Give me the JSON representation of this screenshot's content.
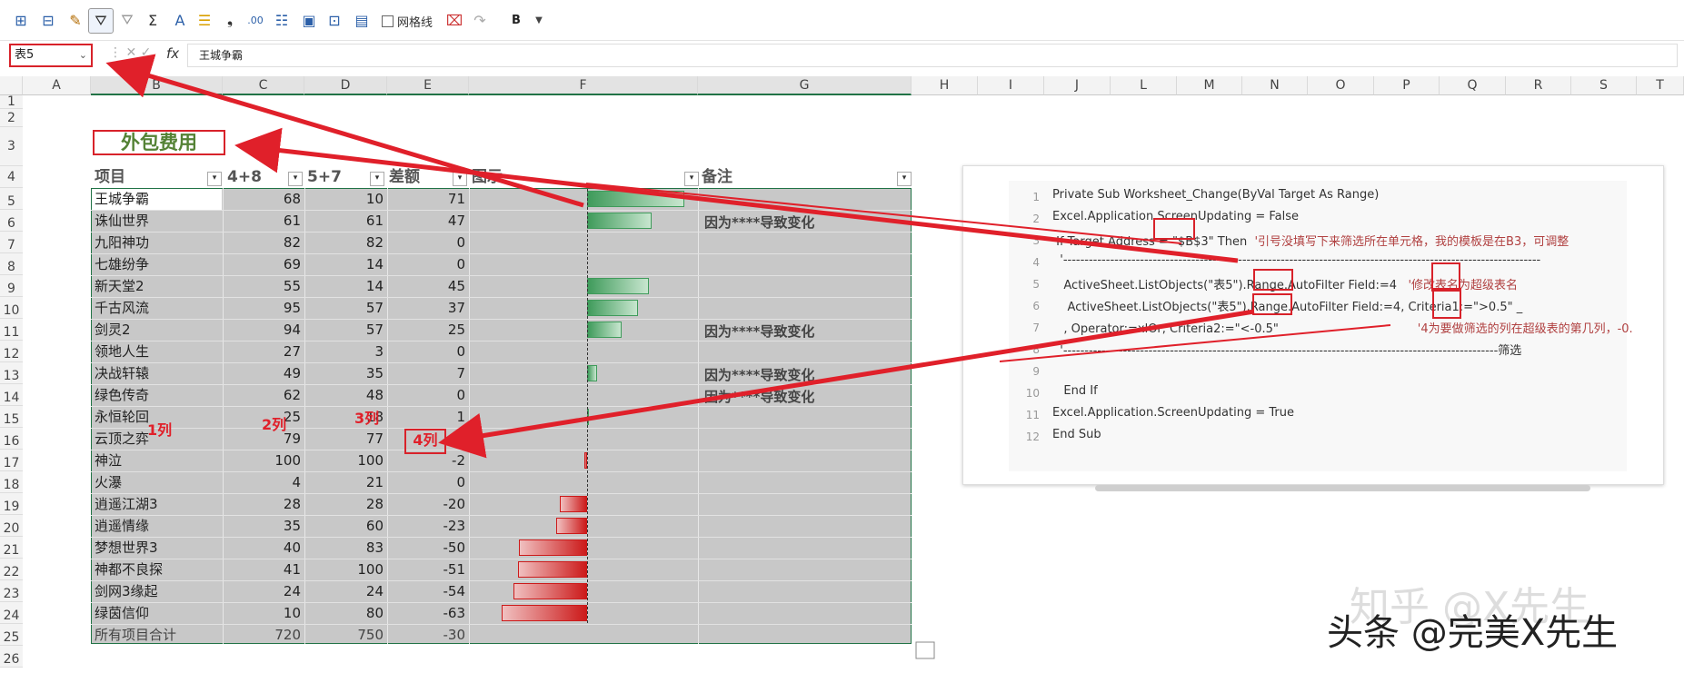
{
  "toolbar": {
    "gridlines_label": "网格线",
    "bold_label": "B"
  },
  "formula_bar": {
    "name_box": "表5",
    "content": "王城争霸",
    "fx": "fx"
  },
  "columns": [
    "A",
    "B",
    "C",
    "D",
    "E",
    "F",
    "G",
    "H",
    "I",
    "J",
    "L",
    "M",
    "N",
    "O",
    "P",
    "Q",
    "R",
    "S",
    "T"
  ],
  "rows": [
    "1",
    "2",
    "3",
    "4",
    "5",
    "6",
    "7",
    "8",
    "9",
    "10",
    "11",
    "12",
    "13",
    "14",
    "15",
    "16",
    "17",
    "18",
    "19",
    "20",
    "21",
    "22",
    "23",
    "24",
    "25",
    "26"
  ],
  "sheet": {
    "title": "外包费用",
    "headers": [
      "项目",
      "4+8",
      "5+7",
      "差额",
      "图示",
      "备注"
    ],
    "data": [
      {
        "name": "王城争霸",
        "a": "68",
        "b": "10",
        "d": "71",
        "note": ""
      },
      {
        "name": "诛仙世界",
        "a": "61",
        "b": "61",
        "d": "47",
        "note": "因为****导致变化"
      },
      {
        "name": "九阳神功",
        "a": "82",
        "b": "82",
        "d": "0",
        "note": ""
      },
      {
        "name": "七雄纷争",
        "a": "69",
        "b": "14",
        "d": "0",
        "note": ""
      },
      {
        "name": "新天堂2",
        "a": "55",
        "b": "14",
        "d": "45",
        "note": ""
      },
      {
        "name": "千古风流",
        "a": "95",
        "b": "57",
        "d": "37",
        "note": ""
      },
      {
        "name": "剑灵2",
        "a": "94",
        "b": "57",
        "d": "25",
        "note": "因为****导致变化"
      },
      {
        "name": "领地人生",
        "a": "27",
        "b": "3",
        "d": "0",
        "note": ""
      },
      {
        "name": "决战轩辕",
        "a": "49",
        "b": "35",
        "d": "7",
        "note": "因为****导致变化"
      },
      {
        "name": "绿色传奇",
        "a": "62",
        "b": "48",
        "d": "0",
        "note": "因为****导致变化"
      },
      {
        "name": "永恒轮回",
        "a": "25",
        "b": "18",
        "d": "1",
        "note": ""
      },
      {
        "name": "云顶之弈",
        "a": "79",
        "b": "77",
        "d": "0",
        "note": ""
      },
      {
        "name": "神泣",
        "a": "100",
        "b": "100",
        "d": "-2",
        "note": ""
      },
      {
        "name": "火瀑",
        "a": "4",
        "b": "21",
        "d": "0",
        "note": ""
      },
      {
        "name": "逍遥江湖3",
        "a": "28",
        "b": "28",
        "d": "-20",
        "note": ""
      },
      {
        "name": "逍遥情缘",
        "a": "35",
        "b": "60",
        "d": "-23",
        "note": ""
      },
      {
        "name": "梦想世界3",
        "a": "40",
        "b": "83",
        "d": "-50",
        "note": ""
      },
      {
        "name": "神都不良探",
        "a": "41",
        "b": "100",
        "d": "-51",
        "note": ""
      },
      {
        "name": "剑网3缘起",
        "a": "24",
        "b": "24",
        "d": "-54",
        "note": ""
      },
      {
        "name": "绿茵信仰",
        "a": "10",
        "b": "80",
        "d": "-63",
        "note": ""
      }
    ],
    "total": {
      "name": "所有项目合计",
      "a": "720",
      "b": "750",
      "d": "-30"
    }
  },
  "annotations": {
    "col1": "1列",
    "col2": "2列",
    "col3": "3列",
    "col4": "4列"
  },
  "code": {
    "lines": [
      {
        "n": "1",
        "t": "Private Sub Worksheet_Change(ByVal Target As Range)"
      },
      {
        "n": "2",
        "t": "Excel.Application.ScreenUpdating = False"
      },
      {
        "n": "3",
        "t": " If Target.Address = \"$B$3\" Then",
        "c": "  '引号没填写下来筛选所在单元格，我的模板是在B3，可调整"
      },
      {
        "n": "4",
        "t": "  '----------------------------------------------------------------------------------------------------------------"
      },
      {
        "n": "5",
        "t": "   ActiveSheet.ListObjects(\"表5\").Range.AutoFilter Field:=4",
        "c": "   '修改表名为超级表名"
      },
      {
        "n": "6",
        "t": "    ActiveSheet.ListObjects(\"表5\").Range.AutoFilter Field:=4, Criteria1:=\">0.5\" _"
      },
      {
        "n": "7",
        "t": "   , Operator:=xlOr, Criteria2:=\"<-0.5\"",
        "c": "                                     '4为要做筛选的列在超级表的第几列，-0."
      },
      {
        "n": "8",
        "t": "  '------------------------------------------------------------------------------------------------------筛选"
      },
      {
        "n": "9",
        "t": ""
      },
      {
        "n": "10",
        "t": "   End If"
      },
      {
        "n": "11",
        "t": "Excel.Application.ScreenUpdating = True"
      },
      {
        "n": "12",
        "t": "End Sub"
      }
    ]
  },
  "watermark": {
    "zhihu": "知乎 @X先生",
    "toutiao": "头条 @完美X先生"
  },
  "colors": {
    "accent_red": "#d8222a",
    "pos_bar": "#3f9b5b",
    "neg_bar": "#cc1a1a",
    "title_green": "#548235",
    "excel_green": "#217346"
  }
}
